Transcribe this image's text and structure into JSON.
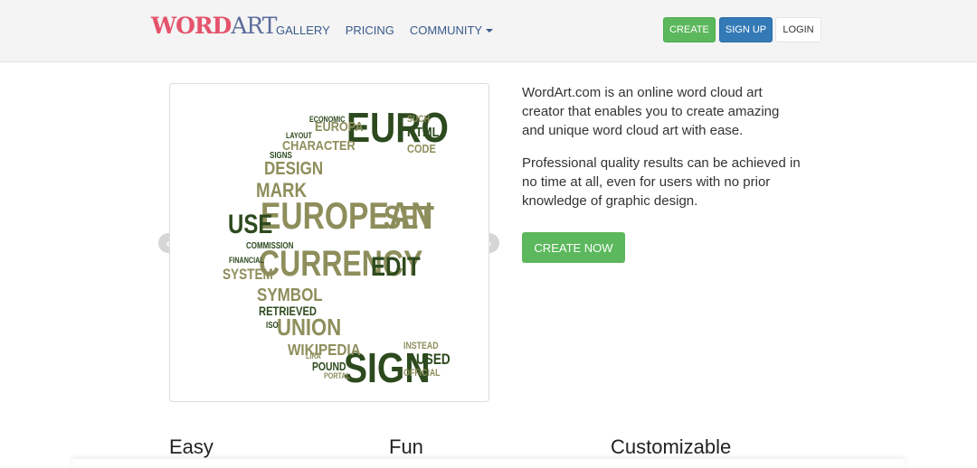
{
  "header": {
    "logo": {
      "part1": "WORD",
      "part2": "ART"
    },
    "nav": [
      {
        "label": "GALLERY"
      },
      {
        "label": "PRICING"
      },
      {
        "label": "COMMUNITY"
      }
    ],
    "buttons": {
      "create": "CREATE",
      "signup": "SIGN UP",
      "login": "LOGIN"
    }
  },
  "carousel": {
    "words": [
      {
        "text": "EURO",
        "color": "#2d4a1e"
      },
      {
        "text": "EUROPEAN",
        "color": "#8e8e5c"
      },
      {
        "text": "USE",
        "color": "#2d4a1e"
      },
      {
        "text": "SET",
        "color": "#8e8e5c"
      },
      {
        "text": "CURRENCY",
        "color": "#8e8e5c"
      },
      {
        "text": "EDIT",
        "color": "#2d4a1e"
      },
      {
        "text": "SIGN",
        "color": "#2d4a1e"
      },
      {
        "text": "UNION",
        "color": "#8e8e5c"
      },
      {
        "text": "WIKIPEDIA",
        "color": "#8e8e5c"
      },
      {
        "text": "MARK",
        "color": "#8e8e5c"
      },
      {
        "text": "DESIGN",
        "color": "#8e8e5c"
      },
      {
        "text": "CHARACTER",
        "color": "#8e8e5c"
      },
      {
        "text": "EUROPA",
        "color": "#8e8e5c"
      },
      {
        "text": "HTML",
        "color": "#2d4a1e"
      },
      {
        "text": "CODE",
        "color": "#8e8e5c"
      },
      {
        "text": "SYMBOL",
        "color": "#8e8e5c"
      },
      {
        "text": "SYSTEM",
        "color": "#8e8e5c"
      },
      {
        "text": "FINANCIAL",
        "color": "#2d4a1e"
      },
      {
        "text": "COMMISSION",
        "color": "#2d4a1e"
      },
      {
        "text": "RETRIEVED",
        "color": "#2d4a1e"
      },
      {
        "text": "POUND",
        "color": "#2d4a1e"
      },
      {
        "text": "USED",
        "color": "#2d4a1e"
      },
      {
        "text": "INSTEAD",
        "color": "#8e8e5c"
      },
      {
        "text": "OFFICIAL",
        "color": "#8e8e5c"
      },
      {
        "text": "SUCH",
        "color": "#8e8e5c"
      },
      {
        "text": "LAYOUT",
        "color": "#2d4a1e"
      },
      {
        "text": "ECONOMIC",
        "color": "#2d4a1e"
      },
      {
        "text": "SIGNS",
        "color": "#2d4a1e"
      },
      {
        "text": "ISO",
        "color": "#2d4a1e"
      },
      {
        "text": "LIRA",
        "color": "#8e8e5c"
      },
      {
        "text": "PORTAL",
        "color": "#8e8e5c"
      }
    ]
  },
  "description": {
    "p1": "WordArt.com is an online word cloud art creator that enables you to create amazing and unique word cloud art with ease.",
    "p2": "Professional quality results can be achieved in no time at all, even for users with no prior knowledge of graphic design.",
    "cta": "CREATE NOW"
  },
  "features": [
    {
      "title": "Easy"
    },
    {
      "title": "Fun"
    },
    {
      "title": "Customizable"
    }
  ]
}
